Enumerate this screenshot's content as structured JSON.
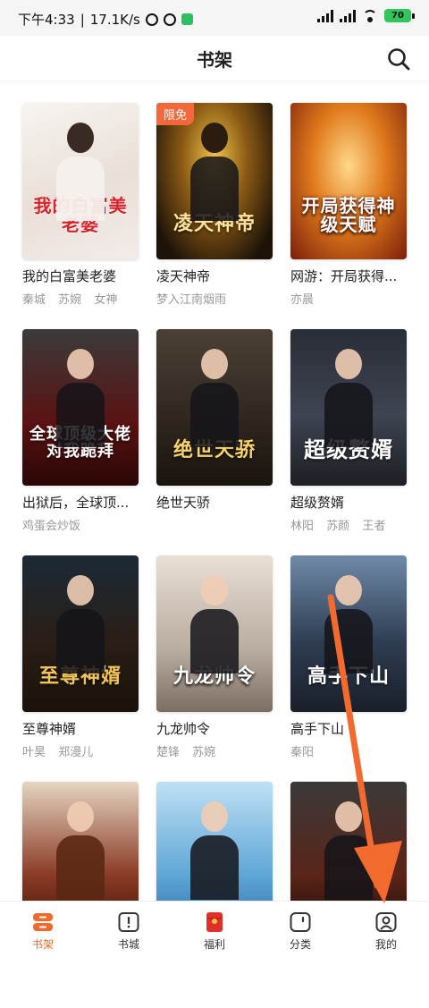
{
  "status": {
    "time": "下午4:33",
    "speed": "17.1K/s",
    "battery": "70"
  },
  "header": {
    "title": "书架"
  },
  "books": [
    {
      "name": "我的白富美老婆",
      "cover_title": "我的白富美老婆",
      "tags": [
        "秦城",
        "苏婉",
        "女神"
      ]
    },
    {
      "name": "凌天神帝",
      "cover_title": "凌天神帝",
      "tags": [
        "梦入江南烟雨"
      ],
      "badge": "限免"
    },
    {
      "name": "网游：开局获得...",
      "cover_title": "开局获得神级天赋",
      "tags": [
        "亦晨"
      ]
    },
    {
      "name": "出狱后，全球顶...",
      "cover_title": "全球顶级大佬对我跪拜",
      "tags": [
        "鸡蛋会炒饭"
      ]
    },
    {
      "name": "绝世天骄",
      "cover_title": "绝世天骄",
      "tags": []
    },
    {
      "name": "超级赘婿",
      "cover_title": "超级赘婿",
      "tags": [
        "林阳",
        "苏颜",
        "王者"
      ]
    },
    {
      "name": "至尊神婿",
      "cover_title": "至尊神婿",
      "tags": [
        "叶昊",
        "郑漫儿"
      ]
    },
    {
      "name": "九龙帅令",
      "cover_title": "九龙帅令",
      "tags": [
        "楚锋",
        "苏婉"
      ]
    },
    {
      "name": "高手下山",
      "cover_title": "高手下山",
      "tags": [
        "秦阳"
      ]
    },
    {
      "name": "",
      "cover_title": "",
      "tags": []
    },
    {
      "name": "",
      "cover_title": "",
      "tags": []
    },
    {
      "name": "",
      "cover_title": "",
      "tags": []
    }
  ],
  "tabs": [
    {
      "label": "书架",
      "icon": "bookshelf-icon",
      "active": true
    },
    {
      "label": "书城",
      "icon": "bookstore-icon"
    },
    {
      "label": "福利",
      "icon": "red-packet-icon"
    },
    {
      "label": "分类",
      "icon": "category-icon"
    },
    {
      "label": "我的",
      "icon": "profile-icon"
    }
  ],
  "colors": {
    "accent": "#ef6a2c",
    "annotation_arrow": "#f26a2e"
  }
}
